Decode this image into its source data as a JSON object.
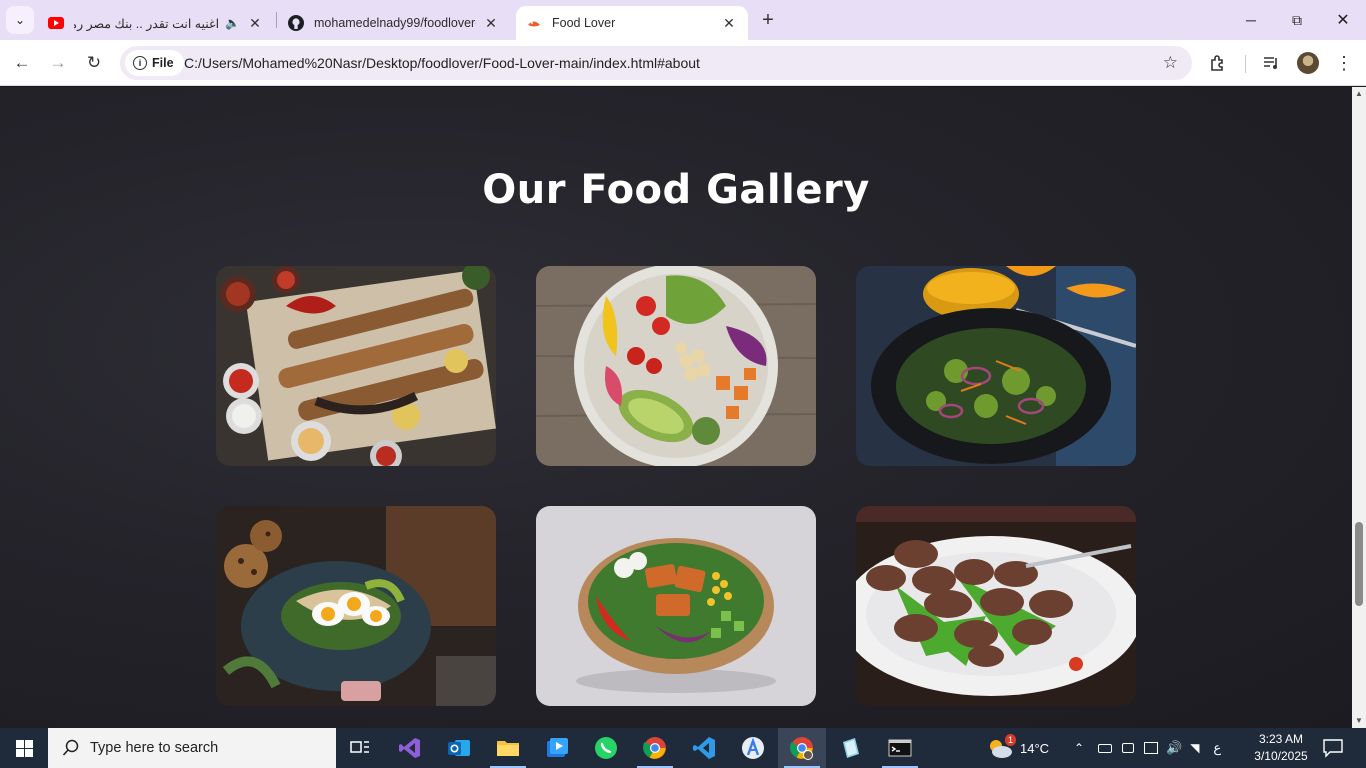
{
  "browser": {
    "tabs": [
      {
        "title": "اغنيه انت تقدر .. بنك مصر رمـ",
        "favicon": "youtube-icon",
        "audio": true
      },
      {
        "title": "mohamedelnady99/foodlover-",
        "favicon": "github-icon"
      },
      {
        "title": "Food Lover",
        "favicon": "food-lover-icon",
        "active": true
      }
    ],
    "address": {
      "chip_label": "File",
      "url": "C:/Users/Mohamed%20Nasr/Desktop/foodlover/Food-Lover-main/index.html#about"
    }
  },
  "page": {
    "gallery_title": "Our Food Gallery",
    "photos": [
      {
        "subject": "grilled-skewers-platter"
      },
      {
        "subject": "veggie-salad-bowl"
      },
      {
        "subject": "leafy-salad-plate-with-orange-juice"
      },
      {
        "subject": "avocado-egg-toast"
      },
      {
        "subject": "chicken-salad-bowl"
      },
      {
        "subject": "meatballs-with-arugula"
      }
    ]
  },
  "taskbar": {
    "search_placeholder": "Type here to search",
    "weather": {
      "temp": "14°C",
      "badge": "1"
    },
    "input_language": "ع",
    "time": "3:23 AM",
    "date": "3/10/2025",
    "accent": "#9ec4ff"
  }
}
